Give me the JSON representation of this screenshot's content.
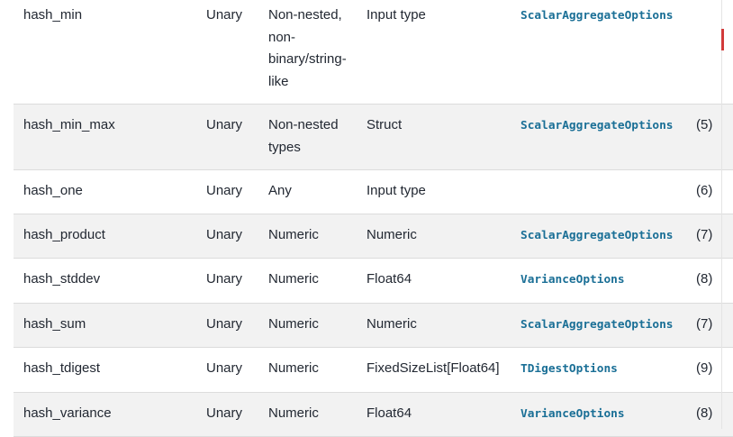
{
  "rows": [
    {
      "name": "hash_min",
      "arity": "Unary",
      "input": "Non-nested, non-binary/string-like",
      "output": "Input type",
      "options": "ScalarAggregateOptions",
      "notes": ""
    },
    {
      "name": "hash_min_max",
      "arity": "Unary",
      "input": "Non-nested types",
      "output": "Struct",
      "options": "ScalarAggregateOptions",
      "notes": "(5)"
    },
    {
      "name": "hash_one",
      "arity": "Unary",
      "input": "Any",
      "output": "Input type",
      "options": "",
      "notes": "(6)"
    },
    {
      "name": "hash_product",
      "arity": "Unary",
      "input": "Numeric",
      "output": "Numeric",
      "options": "ScalarAggregateOptions",
      "notes": "(7)"
    },
    {
      "name": "hash_stddev",
      "arity": "Unary",
      "input": "Numeric",
      "output": "Float64",
      "options": "VarianceOptions",
      "notes": "(8)"
    },
    {
      "name": "hash_sum",
      "arity": "Unary",
      "input": "Numeric",
      "output": "Numeric",
      "options": "ScalarAggregateOptions",
      "notes": "(7)"
    },
    {
      "name": "hash_tdigest",
      "arity": "Unary",
      "input": "Numeric",
      "output": "FixedSizeList[Float64]",
      "options": "TDigestOptions",
      "notes": "(9)"
    },
    {
      "name": "hash_variance",
      "arity": "Unary",
      "input": "Numeric",
      "output": "Float64",
      "options": "VarianceOptions",
      "notes": "(8)"
    }
  ]
}
